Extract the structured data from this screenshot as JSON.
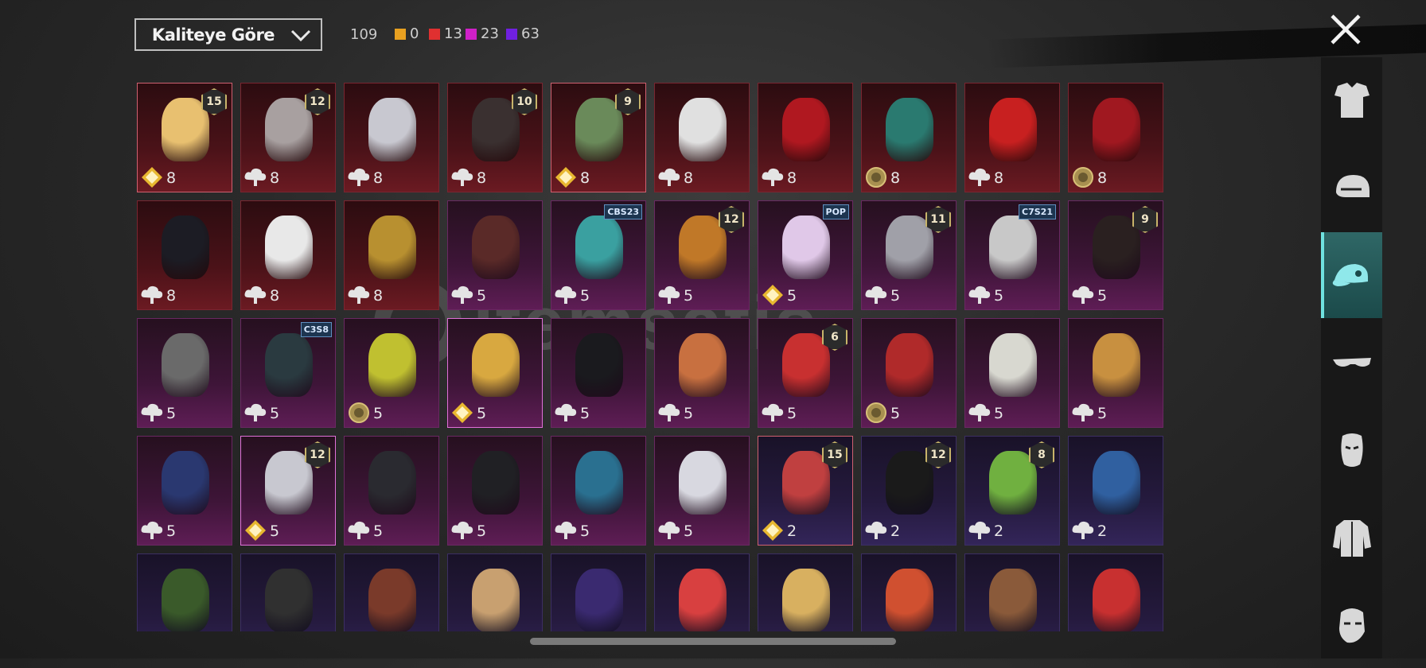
{
  "header": {
    "sort_label": "Kaliteye Göre",
    "total_count": "109",
    "tallies": [
      {
        "color": "#e8a020",
        "value": "0"
      },
      {
        "color": "#e03030",
        "value": "13"
      },
      {
        "color": "#d020c8",
        "value": "23"
      },
      {
        "color": "#7020e0",
        "value": "63"
      }
    ]
  },
  "watermark": "itemsatis",
  "sidebar": {
    "tabs": [
      {
        "name": "outfit-icon",
        "active": false
      },
      {
        "name": "helmet-icon",
        "active": false
      },
      {
        "name": "cap-icon",
        "active": true
      },
      {
        "name": "glasses-icon",
        "active": false
      },
      {
        "name": "mask-icon",
        "active": false
      },
      {
        "name": "jacket-icon",
        "active": false
      },
      {
        "name": "face-icon",
        "active": false
      }
    ]
  },
  "items": [
    {
      "rarity": "red",
      "tier": "gold",
      "qty": "8",
      "badge": "15",
      "color": "#e8c070",
      "sel": true
    },
    {
      "rarity": "red",
      "tier": "cloud",
      "qty": "8",
      "badge": "12",
      "color": "#a8a0a0"
    },
    {
      "rarity": "red",
      "tier": "cloud",
      "qty": "8",
      "badge": "",
      "color": "#c8c8d0"
    },
    {
      "rarity": "red",
      "tier": "cloud",
      "qty": "8",
      "badge": "10",
      "color": "#3a3030"
    },
    {
      "rarity": "red",
      "tier": "gold",
      "qty": "8",
      "badge": "9",
      "color": "#6a8a5a",
      "sel": true
    },
    {
      "rarity": "red",
      "tier": "cloud",
      "qty": "8",
      "badge": "",
      "color": "#e0e0e0"
    },
    {
      "rarity": "red",
      "tier": "cloud",
      "qty": "8",
      "badge": "",
      "color": "#b01820"
    },
    {
      "rarity": "red",
      "tier": "coin",
      "qty": "8",
      "badge": "",
      "color": "#2a7a70"
    },
    {
      "rarity": "red",
      "tier": "cloud",
      "qty": "8",
      "badge": "",
      "color": "#c82020"
    },
    {
      "rarity": "red",
      "tier": "coin",
      "qty": "8",
      "badge": "",
      "color": "#a01820"
    },
    {
      "rarity": "red",
      "tier": "cloud",
      "qty": "8",
      "badge": "",
      "color": "#1c1c24"
    },
    {
      "rarity": "red",
      "tier": "cloud",
      "qty": "8",
      "badge": "",
      "color": "#e8e8e8"
    },
    {
      "rarity": "red",
      "tier": "cloud",
      "qty": "8",
      "badge": "",
      "color": "#b89030"
    },
    {
      "rarity": "pink",
      "tier": "cloud",
      "qty": "5",
      "badge": "",
      "color": "#5a2a28"
    },
    {
      "rarity": "pink",
      "tier": "cloud",
      "qty": "5",
      "badge": "",
      "code": "CBS23",
      "color": "#3aa0a0"
    },
    {
      "rarity": "pink",
      "tier": "cloud",
      "qty": "5",
      "badge": "12",
      "color": "#c07828"
    },
    {
      "rarity": "pink",
      "tier": "gold",
      "qty": "5",
      "badge": "",
      "code": "POP",
      "color": "#e0c8e8"
    },
    {
      "rarity": "pink",
      "tier": "cloud",
      "qty": "5",
      "badge": "11",
      "color": "#a0a0a8"
    },
    {
      "rarity": "pink",
      "tier": "cloud",
      "qty": "5",
      "badge": "",
      "code": "C7S21",
      "color": "#c8c8c8"
    },
    {
      "rarity": "pink",
      "tier": "cloud",
      "qty": "5",
      "badge": "9",
      "color": "#2a2020"
    },
    {
      "rarity": "pink",
      "tier": "cloud",
      "qty": "5",
      "badge": "",
      "color": "#6a6a6a"
    },
    {
      "rarity": "pink",
      "tier": "cloud",
      "qty": "5",
      "badge": "",
      "code": "C3S8",
      "color": "#2a3a40"
    },
    {
      "rarity": "pink",
      "tier": "coin",
      "qty": "5",
      "badge": "",
      "color": "#c0c030"
    },
    {
      "rarity": "pink",
      "tier": "gold",
      "qty": "5",
      "badge": "",
      "color": "#d8a840",
      "sel": true
    },
    {
      "rarity": "pink",
      "tier": "cloud",
      "qty": "5",
      "badge": "",
      "color": "#1a1a1e"
    },
    {
      "rarity": "pink",
      "tier": "cloud",
      "qty": "5",
      "badge": "",
      "color": "#c87040"
    },
    {
      "rarity": "pink",
      "tier": "cloud",
      "qty": "5",
      "badge": "6",
      "color": "#c83030"
    },
    {
      "rarity": "pink",
      "tier": "coin",
      "qty": "5",
      "badge": "",
      "color": "#b02a2a"
    },
    {
      "rarity": "pink",
      "tier": "cloud",
      "qty": "5",
      "badge": "",
      "color": "#d8d8d0"
    },
    {
      "rarity": "pink",
      "tier": "cloud",
      "qty": "5",
      "badge": "",
      "color": "#c89040"
    },
    {
      "rarity": "pink",
      "tier": "cloud",
      "qty": "5",
      "badge": "",
      "color": "#2a3870"
    },
    {
      "rarity": "pink",
      "tier": "gold",
      "qty": "5",
      "badge": "12",
      "color": "#c8c8d0",
      "sel": true
    },
    {
      "rarity": "pink",
      "tier": "cloud",
      "qty": "5",
      "badge": "",
      "color": "#2a2a30"
    },
    {
      "rarity": "pink",
      "tier": "cloud",
      "qty": "5",
      "badge": "",
      "color": "#202024"
    },
    {
      "rarity": "pink",
      "tier": "cloud",
      "qty": "5",
      "badge": "",
      "color": "#2a7090"
    },
    {
      "rarity": "pink",
      "tier": "cloud",
      "qty": "5",
      "badge": "",
      "color": "#d8d8e0"
    },
    {
      "rarity": "purple",
      "tier": "gold",
      "qty": "2",
      "badge": "15",
      "color": "#c04040",
      "sel": true
    },
    {
      "rarity": "purple",
      "tier": "cloud",
      "qty": "2",
      "badge": "12",
      "color": "#1a1a1a"
    },
    {
      "rarity": "purple",
      "tier": "cloud",
      "qty": "2",
      "badge": "8",
      "color": "#70b040"
    },
    {
      "rarity": "purple",
      "tier": "cloud",
      "qty": "2",
      "badge": "",
      "color": "#3060a0"
    },
    {
      "rarity": "purple",
      "tier": "",
      "qty": "",
      "badge": "",
      "color": "#3a5a2a"
    },
    {
      "rarity": "purple",
      "tier": "",
      "qty": "",
      "badge": "",
      "color": "#303030"
    },
    {
      "rarity": "purple",
      "tier": "",
      "qty": "",
      "badge": "",
      "color": "#7a3a2a"
    },
    {
      "rarity": "purple",
      "tier": "",
      "qty": "",
      "badge": "",
      "color": "#c8a070"
    },
    {
      "rarity": "purple",
      "tier": "",
      "qty": "",
      "badge": "",
      "color": "#3a2a70"
    },
    {
      "rarity": "purple",
      "tier": "",
      "qty": "",
      "badge": "",
      "color": "#d84040"
    },
    {
      "rarity": "purple",
      "tier": "",
      "qty": "",
      "badge": "",
      "color": "#d8b060"
    },
    {
      "rarity": "purple",
      "tier": "",
      "qty": "",
      "badge": "",
      "color": "#d05030"
    },
    {
      "rarity": "purple",
      "tier": "",
      "qty": "",
      "badge": "",
      "color": "#8a5a3a"
    },
    {
      "rarity": "purple",
      "tier": "",
      "qty": "",
      "badge": "",
      "color": "#c83030"
    }
  ]
}
